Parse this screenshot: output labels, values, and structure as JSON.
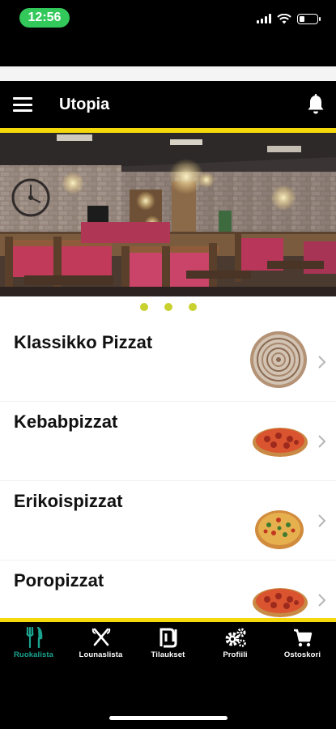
{
  "status_bar": {
    "time": "12:56",
    "time_pill_color": "#32c85a"
  },
  "app_bar": {
    "title": "Utopia",
    "accent_color": "#f5d90a"
  },
  "carousel": {
    "page_count": 3,
    "dot_color": "#c9d12f"
  },
  "menu": {
    "items": [
      {
        "label": "Klassikko Pizzat",
        "icon": "spiral-pizza-image"
      },
      {
        "label": "Kebabpizzat",
        "icon": "pepperoni-pizza-image"
      },
      {
        "label": "Erikoispizzat",
        "icon": "vegetable-pizza-image"
      },
      {
        "label": "Poropizzat",
        "icon": "pepperoni-pizza-image"
      }
    ]
  },
  "tab_bar": {
    "active_color": "#1aa38e",
    "tabs": [
      {
        "label": "Ruokalista",
        "icon": "cutlery-icon",
        "active": true
      },
      {
        "label": "Lounaslista",
        "icon": "fork-knife-cross-icon",
        "active": false
      },
      {
        "label": "Tilaukset",
        "icon": "shekel-icon",
        "active": false
      },
      {
        "label": "Profiili",
        "icon": "gears-icon",
        "active": false
      },
      {
        "label": "Ostoskori",
        "icon": "cart-icon",
        "active": false
      }
    ]
  }
}
